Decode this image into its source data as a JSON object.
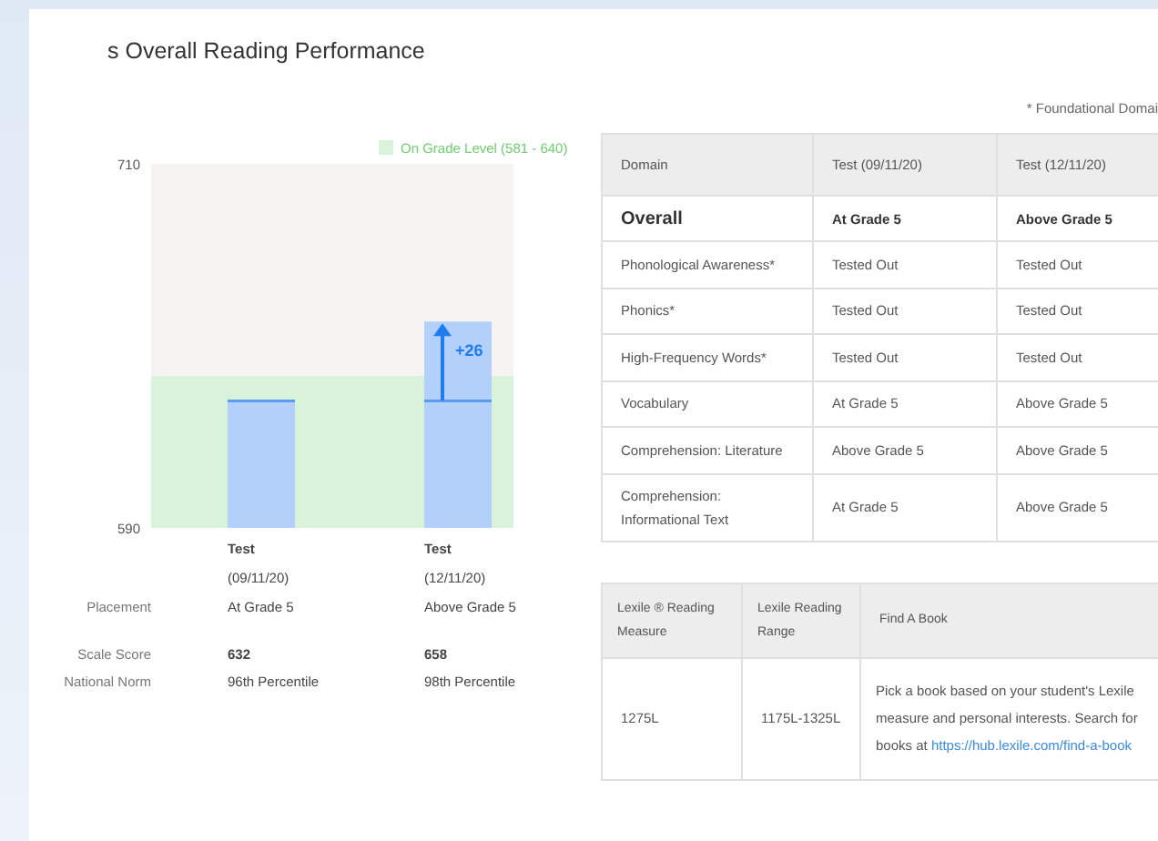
{
  "title": "s Overall Reading Performance",
  "footnote": "* Foundational Domai",
  "chart": {
    "chart_data": {
      "type": "bar",
      "categories": [
        "**Test** (09/11/20)",
        "**Test** (12/11/20)"
      ],
      "values": [
        632,
        658
      ],
      "ylim": [
        590,
        710
      ],
      "yticks": [
        {
          "value": 590,
          "label": "590"
        },
        {
          "value": 710,
          "label": "710"
        }
      ],
      "bands": [
        {
          "axis": "y",
          "from": 581,
          "to": 640,
          "label": "On Grade Level (581 - 640)"
        }
      ],
      "annotations": [
        "+26"
      ]
    }
  },
  "score_rows": [
    {
      "label": "Placement",
      "bold": false,
      "values": [
        "At Grade 5",
        "Above Grade 5"
      ]
    },
    {
      "label": "Scale Score",
      "bold": true,
      "values": [
        "632",
        "658"
      ]
    },
    {
      "label": "National Norm",
      "bold": false,
      "values": [
        "96th Percentile",
        "98th Percentile"
      ]
    }
  ],
  "domain_table": {
    "columns": [
      "Domain",
      "Test (09/11/20)",
      "Test (12/11/20)"
    ],
    "rows": [
      {
        "kind": "overall",
        "cells": [
          "Overall",
          "At Grade 5",
          "Above Grade 5"
        ]
      },
      {
        "kind": "domain",
        "cells": [
          "Phonological Awareness*",
          "Tested Out",
          "Tested Out"
        ]
      },
      {
        "kind": "domain",
        "cells": [
          "Phonics*",
          "Tested Out",
          "Tested Out"
        ]
      },
      {
        "kind": "domain",
        "cells": [
          "High-Frequency Words*",
          "Tested Out",
          "Tested Out"
        ]
      },
      {
        "kind": "domain",
        "cells": [
          "Vocabulary",
          "At Grade 5",
          "Above Grade 5"
        ]
      },
      {
        "kind": "domain",
        "cells": [
          "Comprehension: Literature",
          "Above Grade 5",
          "Above Grade 5"
        ]
      },
      {
        "kind": "domain",
        "cells": [
          "Comprehension: Informational Text",
          "At Grade 5",
          "Above Grade 5"
        ]
      }
    ]
  },
  "lexile_table": {
    "columns": [
      "Lexile ® Reading Measure",
      "Lexile Reading Range",
      "Find A Book"
    ],
    "measure": "1275L",
    "range": "1175L-1325L",
    "find_text": "Pick a book based on your student's Lexile measure and personal interests. Search for books at",
    "link": "https://hub.lexile.com/find-a-book"
  }
}
